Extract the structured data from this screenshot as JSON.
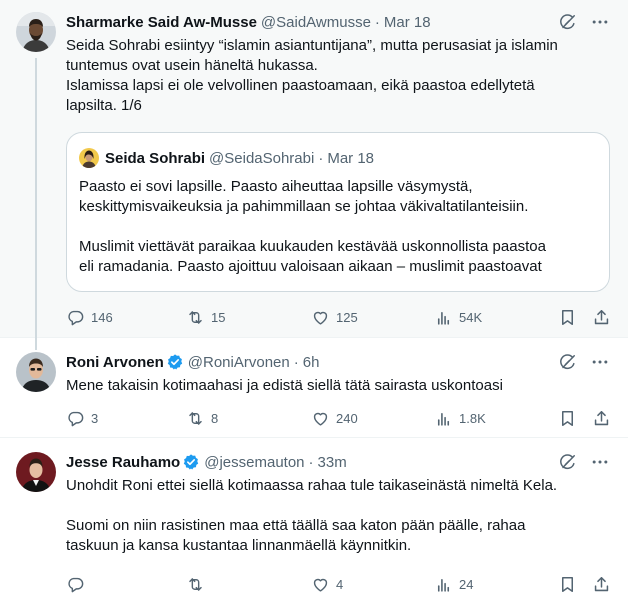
{
  "tweets": [
    {
      "author": "Sharmarke Said Aw-Musse",
      "handle": "@SaidAwmusse",
      "separator": "·",
      "time": "Mar 18",
      "text": "Seida Sohrabi esiintyy “islamin asiantuntijana”, mutta perusasiat ja islamin\ntuntemus ovat usein häneltä hukassa.\nIslamissa lapsi ei ole velvollinen paastoamaan, eikä paastoa edellytetä\nlapsilta. 1/6",
      "quote": {
        "author": "Seida Sohrabi",
        "handle": "@SeidaSohrabi",
        "separator": "·",
        "time": "Mar 18",
        "paragraphs": [
          "Paasto ei sovi lapsille. Paasto aiheuttaa lapsille väsymystä,\nkeskittymisvaikeuksia ja pahimmillaan se johtaa väkivaltatilanteisiin.",
          "Muslimit viettävät paraikaa kuukauden kestävää uskonnollista paastoa\neli ramadania. Paasto ajoittuu valoisaan aikaan – muslimit paastoavat"
        ]
      },
      "replies": "146",
      "retweets": "15",
      "likes": "125",
      "views": "54K"
    },
    {
      "author": "Roni Arvonen",
      "handle": "@RoniArvonen",
      "separator": "·",
      "time": "6h",
      "verified": true,
      "text": "Mene takaisin kotimaahasi ja edistä siellä tätä sairasta uskontoasi",
      "replies": "3",
      "retweets": "8",
      "likes": "240",
      "views": "1.8K"
    },
    {
      "author": "Jesse Rauhamo",
      "handle": "@jessemauton",
      "separator": "·",
      "time": "33m",
      "verified": true,
      "paragraphs": [
        "Unohdit Roni ettei siellä kotimaassa rahaa tule taikaseinästä nimeltä Kela.",
        "Suomi on niin rasistinen maa että täällä saa katon pään päälle, rahaa\ntaskuun ja kansa kustantaa linnanmäellä käynnitkin."
      ],
      "replies": "",
      "retweets": "",
      "likes": "4",
      "views": "24"
    }
  ],
  "colors": {
    "text": "#0f1419",
    "secondary": "#536471",
    "verified": "#1d9bf0",
    "border": "#cfd9de",
    "highlight_bg": "#f7f9f9"
  },
  "icons": [
    "grok-icon",
    "more-icon",
    "reply-icon",
    "retweet-icon",
    "like-icon",
    "views-icon",
    "bookmark-icon",
    "share-icon",
    "verified-badge-icon"
  ]
}
